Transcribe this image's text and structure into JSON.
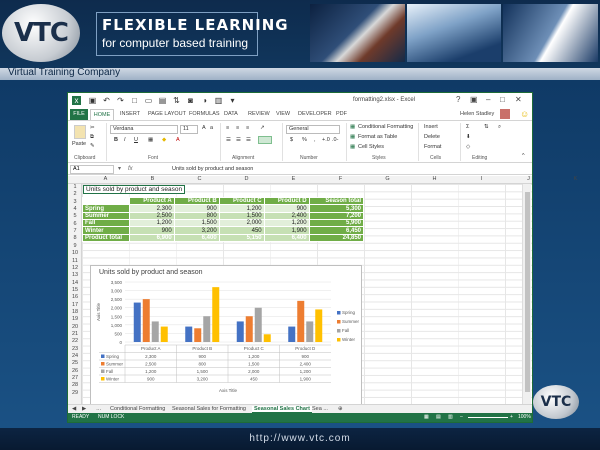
{
  "banner": {
    "logo": "VTC",
    "title_line1": "FLEXIBLE LEARNING",
    "title_line2": "for computer based training",
    "company": "Virtual Training Company",
    "corner_logo": "VTC",
    "url": "http://www.vtc.com"
  },
  "excel": {
    "window_title": "formatting2.xlsx - Excel",
    "user": "Helen Stadley",
    "tabs": [
      "FILE",
      "HOME",
      "INSERT",
      "PAGE LAYOUT",
      "FORMULAS",
      "DATA",
      "REVIEW",
      "VIEW",
      "DEVELOPER",
      "PDF"
    ],
    "ribbon": {
      "paste": "Paste",
      "font_name": "Verdana",
      "font_size": "11",
      "number_format": "General",
      "conditional_formatting": "Conditional Formatting",
      "format_as_table": "Format as Table",
      "cell_styles": "Cell Styles",
      "insert": "Insert",
      "delete": "Delete",
      "format": "Format",
      "groups": [
        "Clipboard",
        "Font",
        "Alignment",
        "Number",
        "Styles",
        "Cells",
        "Editing"
      ]
    },
    "name_box": "A1",
    "fx": "fx",
    "formula_value": "Units sold by product and season",
    "columns": [
      "A",
      "B",
      "C",
      "D",
      "E",
      "F",
      "G",
      "H",
      "I",
      "J",
      "K"
    ],
    "rows": [
      "1",
      "2",
      "3",
      "4",
      "5",
      "6",
      "7",
      "8",
      "9",
      "10",
      "11",
      "12",
      "13",
      "14",
      "15",
      "16",
      "17",
      "18",
      "19",
      "20",
      "21",
      "22",
      "23",
      "24",
      "25",
      "26",
      "27",
      "28",
      "29"
    ],
    "a1_text": "Units sold by product and season",
    "table": {
      "headers": [
        "Product A",
        "Product B",
        "Product C",
        "Product D",
        "Season total"
      ],
      "rows": [
        {
          "label": "Spring",
          "values": [
            "2,300",
            "900",
            "1,200",
            "900"
          ],
          "total": "5,300"
        },
        {
          "label": "Summer",
          "values": [
            "2,500",
            "800",
            "1,500",
            "2,400"
          ],
          "total": "7,200"
        },
        {
          "label": "Fall",
          "values": [
            "1,200",
            "1,500",
            "2,000",
            "1,200"
          ],
          "total": "5,900"
        },
        {
          "label": "Winter",
          "values": [
            "900",
            "3,200",
            "450",
            "1,900"
          ],
          "total": "6,450"
        }
      ],
      "total_row": {
        "label": "Product total",
        "values": [
          "6,900",
          "6,400",
          "5,150",
          "6,400"
        ],
        "total": "24,850"
      }
    },
    "sheets": [
      "Conditional Formatting",
      "Seasonal Sales for Formatting",
      "Seasonal Sales Chart",
      "Sea ..."
    ],
    "status_left": "READY",
    "status_mid": "NUM LOCK",
    "zoom": "100%"
  },
  "chart_data": {
    "type": "bar",
    "title": "Units sold by product and season",
    "xlabel": "Axis Title",
    "ylabel": "Axis Title",
    "categories": [
      "Product A",
      "Product B",
      "Product C",
      "Product D"
    ],
    "series": [
      {
        "name": "Spring",
        "values": [
          2300,
          900,
          1200,
          900
        ],
        "color": "#4472c4"
      },
      {
        "name": "Summer",
        "values": [
          2500,
          800,
          1500,
          2400
        ],
        "color": "#ed7d31"
      },
      {
        "name": "Fall",
        "values": [
          1200,
          1500,
          2000,
          1200
        ],
        "color": "#a5a5a5"
      },
      {
        "name": "Winter",
        "values": [
          900,
          3200,
          450,
          1900
        ],
        "color": "#ffc000"
      }
    ],
    "yticks": [
      "0",
      "500",
      "1,000",
      "1,500",
      "2,000",
      "2,500",
      "3,000",
      "3,500"
    ],
    "ylim": [
      0,
      3500
    ],
    "legend": "right",
    "data_table": [
      [
        "2,300",
        "900",
        "1,200",
        "900"
      ],
      [
        "2,500",
        "800",
        "1,500",
        "2,400"
      ],
      [
        "1,200",
        "1,500",
        "2,000",
        "1,200"
      ],
      [
        "900",
        "3,200",
        "450",
        "1,900"
      ]
    ]
  }
}
